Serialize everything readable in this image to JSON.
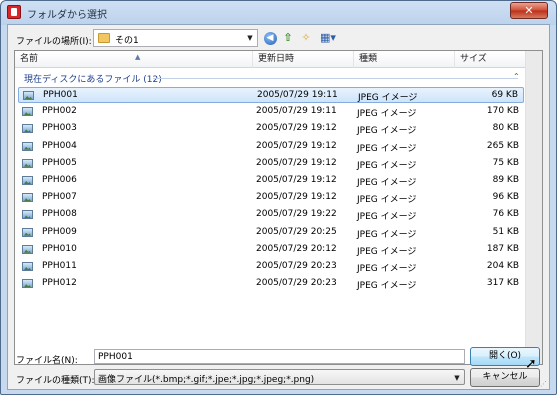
{
  "window": {
    "title": "フォルダから選択",
    "close_glyph": "✕"
  },
  "toolbar": {
    "look_in_label": "ファイルの場所(I):",
    "look_in_value": "その1",
    "back_glyph": "◀",
    "up_glyph": "⇧",
    "new_folder_glyph": "✧",
    "view_glyph": "▦▾"
  },
  "columns": {
    "name": "名前",
    "date": "更新日時",
    "type": "種類",
    "size": "サイズ"
  },
  "group": {
    "label": "現在ディスクにあるファイル (12)",
    "toggle_glyph": "⌃"
  },
  "files": [
    {
      "name": "PPH001",
      "date": "2005/07/29 19:11",
      "type": "JPEG イメージ",
      "size": "69 KB",
      "selected": true
    },
    {
      "name": "PPH002",
      "date": "2005/07/29 19:11",
      "type": "JPEG イメージ",
      "size": "170 KB",
      "selected": false
    },
    {
      "name": "PPH003",
      "date": "2005/07/29 19:12",
      "type": "JPEG イメージ",
      "size": "80 KB",
      "selected": false
    },
    {
      "name": "PPH004",
      "date": "2005/07/29 19:12",
      "type": "JPEG イメージ",
      "size": "265 KB",
      "selected": false
    },
    {
      "name": "PPH005",
      "date": "2005/07/29 19:12",
      "type": "JPEG イメージ",
      "size": "75 KB",
      "selected": false
    },
    {
      "name": "PPH006",
      "date": "2005/07/29 19:12",
      "type": "JPEG イメージ",
      "size": "89 KB",
      "selected": false
    },
    {
      "name": "PPH007",
      "date": "2005/07/29 19:12",
      "type": "JPEG イメージ",
      "size": "96 KB",
      "selected": false
    },
    {
      "name": "PPH008",
      "date": "2005/07/29 19:22",
      "type": "JPEG イメージ",
      "size": "76 KB",
      "selected": false
    },
    {
      "name": "PPH009",
      "date": "2005/07/29 20:25",
      "type": "JPEG イメージ",
      "size": "51 KB",
      "selected": false
    },
    {
      "name": "PPH010",
      "date": "2005/07/29 20:12",
      "type": "JPEG イメージ",
      "size": "187 KB",
      "selected": false
    },
    {
      "name": "PPH011",
      "date": "2005/07/29 20:23",
      "type": "JPEG イメージ",
      "size": "204 KB",
      "selected": false
    },
    {
      "name": "PPH012",
      "date": "2005/07/29 20:23",
      "type": "JPEG イメージ",
      "size": "317 KB",
      "selected": false
    }
  ],
  "footer": {
    "filename_label": "ファイル名(N):",
    "filename_value": "PPH001",
    "filetype_label": "ファイルの種類(T):",
    "filetype_value": "画像ファイル(*.bmp;*.gif;*.jpe;*.jpg;*.jpeg;*.png)",
    "open_label": "開く(O)",
    "cancel_label": "キャンセル"
  },
  "colors": {
    "selection_border": "#84acdd",
    "group_header": "#1e3f8c",
    "title_bar": "#bcd2ec"
  }
}
